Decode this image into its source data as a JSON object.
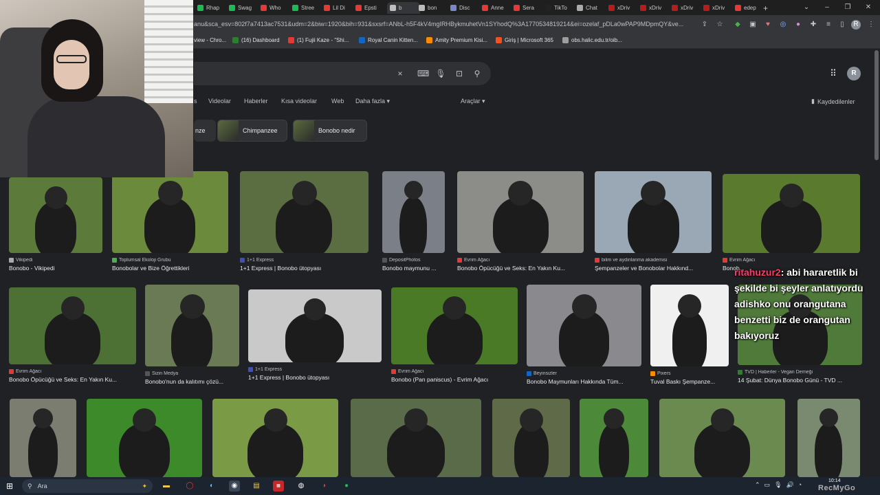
{
  "browser": {
    "tabs": [
      "Rhap",
      "Swag",
      "Who",
      "Stree",
      "Lil Di",
      "Epsti",
      "b",
      "bon",
      "Disc",
      "Anne",
      "Sera",
      "TikTo",
      "Chat",
      "xDriv",
      "xDriv",
      "xDriv",
      "xDriv",
      "edep"
    ],
    "new_tab": "+",
    "url": "anu&sca_esv=802f7a7413ac7531&udm=2&biw=1920&bih=931&sxsrf=ANbL-h5F4kV4mgIRHBykmuhetVn1SYhodQ%3A1770534819214&ei=ozelaf_pDLa0wPAP9MDpmQY&ve...",
    "bookmarks": [
      "view - Chro...",
      "(16) Dashboard",
      "(1) Fujii Kaze - \"Shi...",
      "Royal Canin Kitten...",
      "Amity Premium Kisi...",
      "Giriş | Microsoft 365",
      "obs.halic.edu.tr/oib..."
    ]
  },
  "search": {
    "clear_icon": "×",
    "avatar": "R",
    "nav": [
      "s",
      "Videolar",
      "Haberler",
      "Kısa videolar",
      "Web",
      "Daha fazla",
      "Araçlar"
    ],
    "saved": "Kaydedilenler",
    "chips": [
      "nze",
      "Chimpanzee",
      "Bonobo nedir"
    ]
  },
  "results": [
    {
      "src": "Vikipedi",
      "title": "Bonobo - Vikipedi",
      "bg": "#5c7a3a"
    },
    {
      "src": "Toplumsal Ekoloji Grubu",
      "title": "Bonobolar ve Bize Öğrettikleri",
      "bg": "#6b8a3c"
    },
    {
      "src": "1+1 Express",
      "title": "1+1 Express | Bonobo ütopyası",
      "bg": "#5a6e42"
    },
    {
      "src": "DepositPhotos",
      "title": "Bonobo maymunu ...",
      "bg": "#7a7f88"
    },
    {
      "src": "Evrim Ağacı",
      "title": "Bonobo Öpücüğü ve Seks: En Yakın Ku...",
      "bg": "#8c8c88"
    },
    {
      "src": "bilim ve aydınlanma akademisi",
      "title": "Şempanzeler ve Bonobolar Hakkınd...",
      "bg": "#9aa8b5"
    },
    {
      "src": "Evrim Ağacı",
      "title": "Bonob...",
      "bg": "#5a7a2e"
    },
    {
      "src": "Evrim Ağacı",
      "title": "Bonobo Öpücüğü ve Seks: En Yakın Ku...",
      "bg": "#4d7035"
    },
    {
      "src": "Sizin Medya",
      "title": "Bonobo'nun da kalıtımı çözü...",
      "bg": "#6a7a55"
    },
    {
      "src": "1+1 Express",
      "title": "1+1 Express | Bonobo ütopyası",
      "bg": "#c9c9c9"
    },
    {
      "src": "Evrim Ağacı",
      "title": "Bonobo (Pan paniscus) - Evrim Ağacı",
      "bg": "#4a7a25"
    },
    {
      "src": "Beyinsizler",
      "title": "Bonobo Maymunları Hakkında Tüm...",
      "bg": "#8a8a8e"
    },
    {
      "src": "Pixers",
      "title": "Tuval Baskı Şempanze...",
      "bg": "#f0f0f0"
    },
    {
      "src": "TVD | Haberler - Vegan Derneği",
      "title": "14 Şubat: Dünya Bonobo Günü - TVD ...",
      "bg": "#4f7a3a"
    },
    {
      "src": "",
      "title": "",
      "bg": "#7a7d70"
    },
    {
      "src": "",
      "title": "",
      "bg": "#3d8a2a"
    },
    {
      "src": "",
      "title": "",
      "bg": "#7a9a45"
    },
    {
      "src": "",
      "title": "",
      "bg": "#5a6b4a"
    },
    {
      "src": "",
      "title": "",
      "bg": "#5e6a48"
    },
    {
      "src": "",
      "title": "",
      "bg": "#4c8a3a"
    },
    {
      "src": "",
      "title": "",
      "bg": "#6a8a50"
    },
    {
      "src": "",
      "title": "",
      "bg": "#7a8a70"
    }
  ],
  "overlay_chat": {
    "user": "ritahuzur2",
    "message": "abi hararetlik bi şekilde bi şeyler anlatıyordu adishko onu orangutana benzetti biz de orangutan bakıyoruz"
  },
  "taskbar": {
    "search_placeholder": "Ara",
    "clock": "10:14",
    "watermark": "RecMyGo"
  },
  "colors": {
    "background": "#202124",
    "accent": "#8ab4f8",
    "chat_user": "#ff3b6b"
  }
}
